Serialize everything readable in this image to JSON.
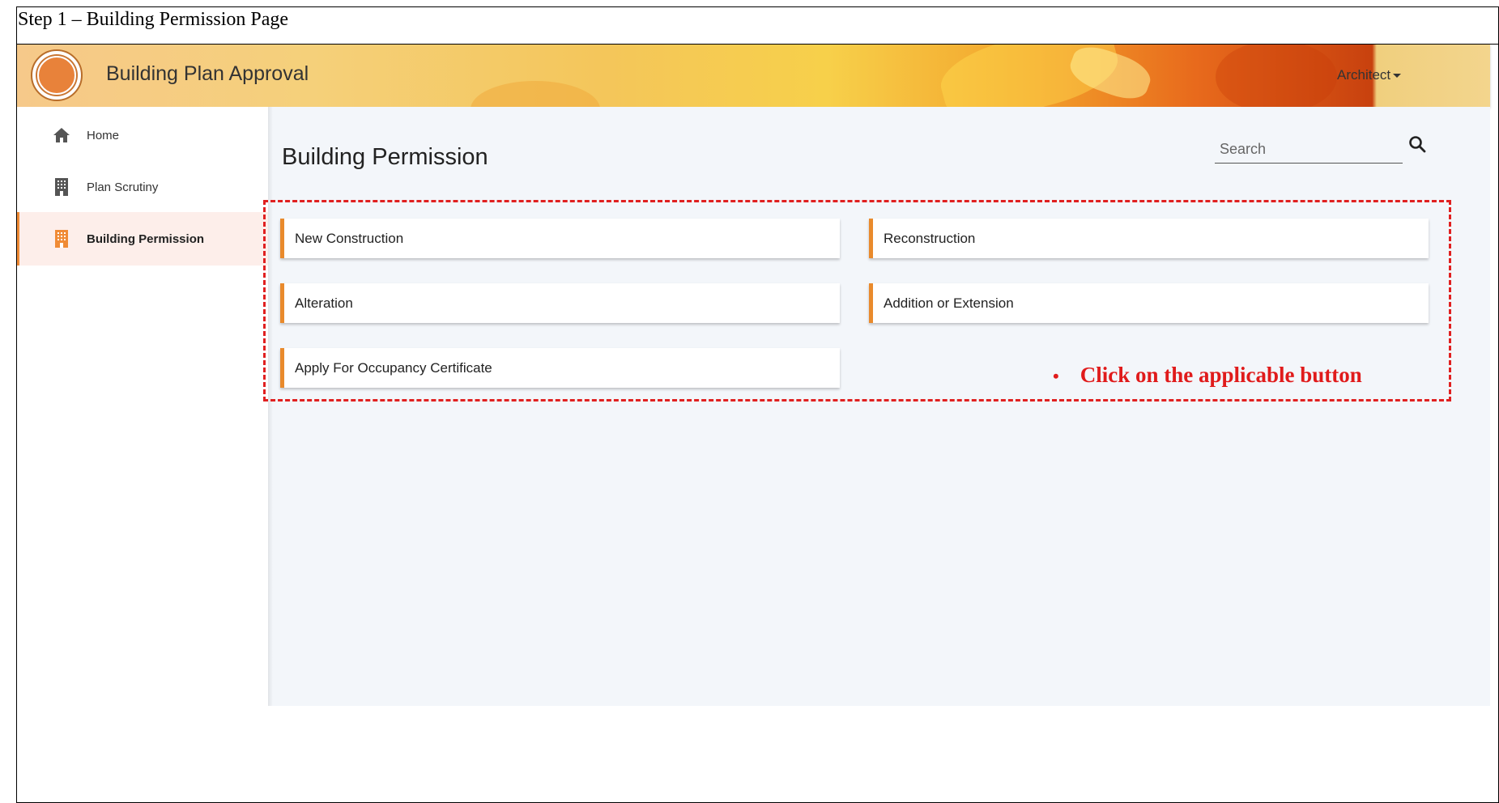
{
  "document": {
    "step_title": "Step 1 – Building Permission Page"
  },
  "header": {
    "app_title": "Building Plan Approval",
    "user_menu_label": "Architect"
  },
  "sidebar": {
    "items": [
      {
        "label": "Home",
        "icon": "home-icon",
        "active": false
      },
      {
        "label": "Plan Scrutiny",
        "icon": "building-icon",
        "active": false
      },
      {
        "label": "Building Permission",
        "icon": "building-icon",
        "active": true
      }
    ]
  },
  "main": {
    "page_title": "Building Permission",
    "search": {
      "placeholder": "Search",
      "value": ""
    },
    "options": [
      {
        "label": "New Construction"
      },
      {
        "label": "Reconstruction"
      },
      {
        "label": "Alteration"
      },
      {
        "label": "Addition or Extension"
      },
      {
        "label": "Apply For Occupancy Certificate"
      }
    ]
  },
  "annotation": {
    "bullet": "•",
    "text": "Click on the applicable button"
  },
  "colors": {
    "accent": "#e98a2c",
    "annotation_red": "#e01b1b",
    "main_bg": "#f3f6fa",
    "active_item_bg": "#fdeeea"
  }
}
